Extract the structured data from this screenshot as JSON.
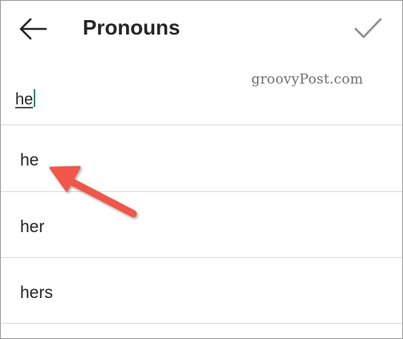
{
  "header": {
    "title": "Pronouns",
    "back_icon": "arrow-left-icon",
    "confirm_icon": "checkmark-icon"
  },
  "search": {
    "value": "he"
  },
  "watermark": "groovyPost.com",
  "suggestions": [
    {
      "label": "he"
    },
    {
      "label": "her"
    },
    {
      "label": "hers"
    }
  ],
  "colors": {
    "arrow": "#f0574a",
    "caret": "#1f8f7a",
    "divider": "#dbdbdb",
    "text": "#262626"
  }
}
